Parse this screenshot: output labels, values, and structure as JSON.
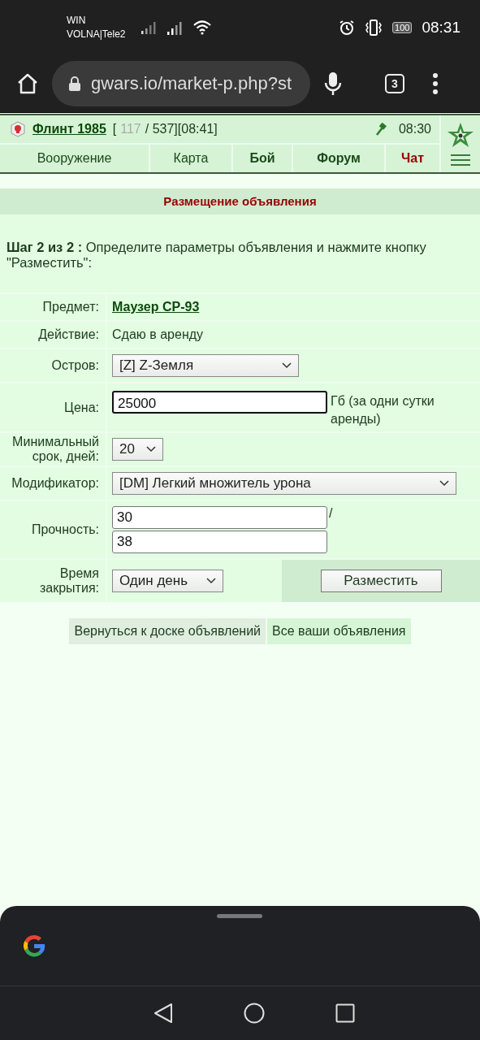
{
  "status_bar": {
    "carrier_line_1": "WIN",
    "carrier_line_2": "VOLNA|Tele2",
    "battery": "100",
    "time": "08:31"
  },
  "browser": {
    "url": "gwars.io/market-p.php?st",
    "tab_count": "3"
  },
  "header": {
    "player": "Флинт 1985",
    "bracket_open": "[",
    "hp_current": "117",
    "hp_rest": "/ 537][08:41]",
    "server_time": "08:30"
  },
  "nav": [
    {
      "label": "Вооружение",
      "kind": "plain"
    },
    {
      "label": "Карта",
      "kind": "plain"
    },
    {
      "label": "Бой",
      "kind": "bold"
    },
    {
      "label": "Форум",
      "kind": "bold"
    },
    {
      "label": "Чат",
      "kind": "alert"
    }
  ],
  "panel": {
    "title": "Размещение объявления",
    "step": "**Шаг 2 из 2 :** Определите параметры объявления и нажмите кнопку \"Разместить\":"
  },
  "rows": [
    {
      "label": "Предмет:",
      "kind": "link",
      "value": "Маузер СР-93"
    },
    {
      "label": "Действие:",
      "kind": "text",
      "value": "Сдаю в аренду"
    },
    {
      "label": "Остров:",
      "kind": "select",
      "value": "[Z] Z-Земля"
    },
    {
      "label": "Цена:",
      "kind": "input",
      "value": "25000",
      "focused": true,
      "suffix": "Гб (за одни сутки аренды)"
    },
    {
      "label": "Минимальный срок, дней:",
      "kind": "select",
      "value": "20"
    },
    {
      "label": "Модификатор:",
      "kind": "select",
      "value": "[DM] Легкий множитель урона"
    },
    {
      "label": "Прочность:",
      "kind": "pair",
      "values": [
        "30",
        "38"
      ],
      "separator": "/"
    },
    {
      "label": "Время закрытия:",
      "kind": "select_button",
      "value": "Один день",
      "button": "Разместить"
    }
  ],
  "links": [
    "Вернуться к доске объявлений",
    "Все ваши объявления"
  ]
}
